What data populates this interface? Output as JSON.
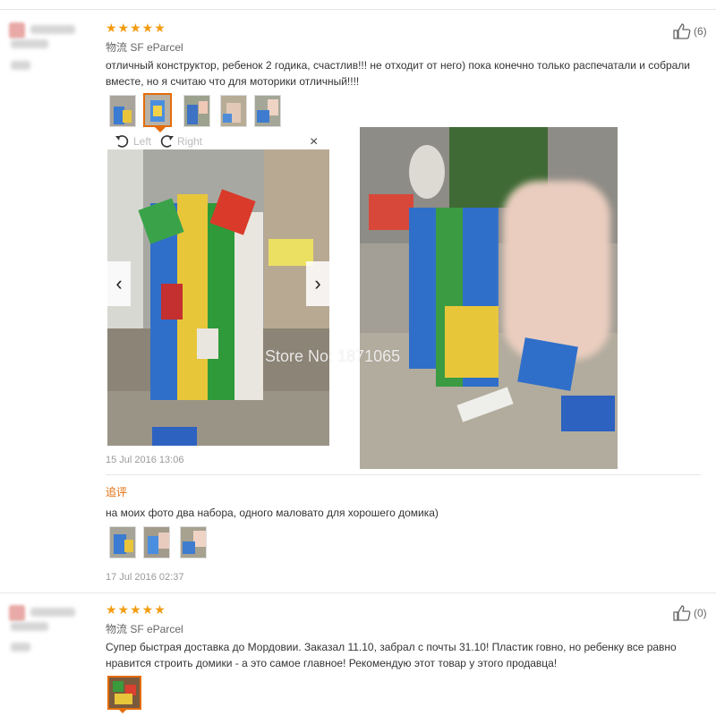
{
  "review1": {
    "rating": "★★★★★",
    "logistics": "物流 SF eParcel",
    "likes": "(6)",
    "text": "отличный конструктор, ребенок 2 годика, счастлив!!! не отходит от него) пока конечно только распечатали и собрали вместе, но я считаю что для моторики отличный!!!!",
    "viewer": {
      "rotate_left": "Left",
      "rotate_right": "Right",
      "close": "×",
      "prev": "‹",
      "next": "›"
    },
    "watermark": "Store No: 1871065",
    "date": "15 Jul 2016 13:06",
    "followup_label": "追评",
    "followup_text": "на моих фото два набора, одного маловато для хорошего домика)",
    "followup_date": "17 Jul 2016 02:37"
  },
  "review2": {
    "rating": "★★★★★",
    "logistics": "物流 SF eParcel",
    "likes": "(0)",
    "text": "Супер быстрая доставка до Мордовии. Заказал 11.10, забрал с почты 31.10! Пластик говно, но ребенку все равно нравится строить домики - а это самое главное! Рекомендую этот товар у этого продавца!"
  },
  "colors": {
    "star": "#f39c12",
    "accent": "#e46c0a",
    "date": "#999999"
  },
  "icons": {
    "like": "thumbs-up-icon",
    "rotate_left": "rotate-left-icon",
    "rotate_right": "rotate-right-icon"
  }
}
